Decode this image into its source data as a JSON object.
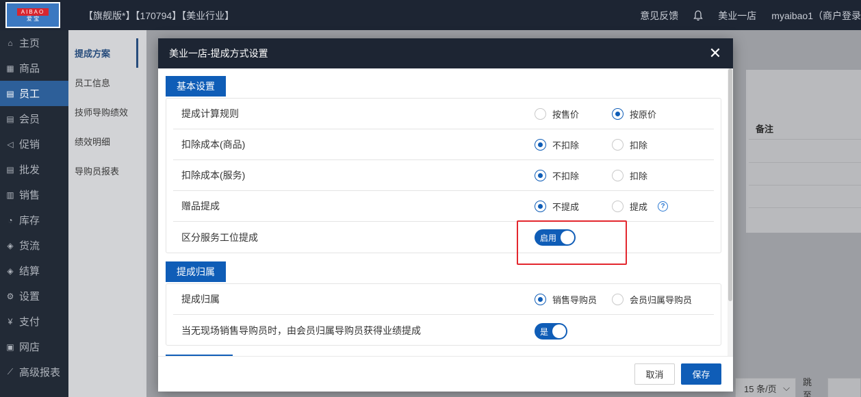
{
  "topbar": {
    "logo_top": "AIBAO",
    "logo_bottom": "爱 宝",
    "store_info": "【旗舰版*】【170794】【美业行业】",
    "feedback": "意见反馈",
    "store_name": "美业一店",
    "user": "myaibao1（商户登录"
  },
  "sidebar": {
    "items": [
      {
        "label": "主页",
        "icon": "home-icon",
        "glyph": "⌂"
      },
      {
        "label": "商品",
        "icon": "goods-icon",
        "glyph": "▦"
      },
      {
        "label": "员工",
        "icon": "staff-icon",
        "glyph": "▤"
      },
      {
        "label": "会员",
        "icon": "member-icon",
        "glyph": "▤"
      },
      {
        "label": "促销",
        "icon": "promo-icon",
        "glyph": "◁"
      },
      {
        "label": "批发",
        "icon": "wholesale-icon",
        "glyph": "▤"
      },
      {
        "label": "销售",
        "icon": "sales-icon",
        "glyph": "▥"
      },
      {
        "label": "库存",
        "icon": "stock-icon",
        "glyph": "◔"
      },
      {
        "label": "货流",
        "icon": "logistics-icon",
        "glyph": "◈"
      },
      {
        "label": "结算",
        "icon": "settle-icon",
        "glyph": "◈"
      },
      {
        "label": "设置",
        "icon": "settings-icon",
        "glyph": "⚙"
      },
      {
        "label": "支付",
        "icon": "pay-icon",
        "glyph": "¥"
      },
      {
        "label": "网店",
        "icon": "shop-icon",
        "glyph": "▣"
      },
      {
        "label": "高级报表",
        "icon": "report-icon",
        "glyph": "⟋"
      }
    ]
  },
  "subnav": {
    "items": [
      "提成方案",
      "员工信息",
      "技师导购绩效",
      "绩效明细",
      "导购员报表"
    ]
  },
  "content": {
    "note_header": "备注",
    "per_page": "15 条/页",
    "jump_label": "跳至"
  },
  "modal": {
    "title": "美业一店-提成方式设置",
    "section1_title": "基本设置",
    "section2_title": "提成归属",
    "rows1": [
      {
        "label": "提成计算规则",
        "opt1": "按售价",
        "opt2": "按原价"
      },
      {
        "label": "扣除成本(商品)",
        "opt1": "不扣除",
        "opt2": "扣除"
      },
      {
        "label": "扣除成本(服务)",
        "opt1": "不扣除",
        "opt2": "扣除"
      },
      {
        "label": "赠品提成",
        "opt1": "不提成",
        "opt2": "提成"
      },
      {
        "label": "区分服务工位提成",
        "toggle": "启用"
      }
    ],
    "rows2": [
      {
        "label": "提成归属",
        "opt1": "销售导购员",
        "opt2": "会员归属导购员"
      },
      {
        "label": "当无现场销售导购员时，由会员归属导购员获得业绩提成",
        "toggle": "是"
      }
    ],
    "cancel": "取消",
    "save": "保存"
  },
  "colors": {
    "primary": "#0f5db7",
    "header": "#1d2533",
    "highlight": "#e3262d"
  }
}
